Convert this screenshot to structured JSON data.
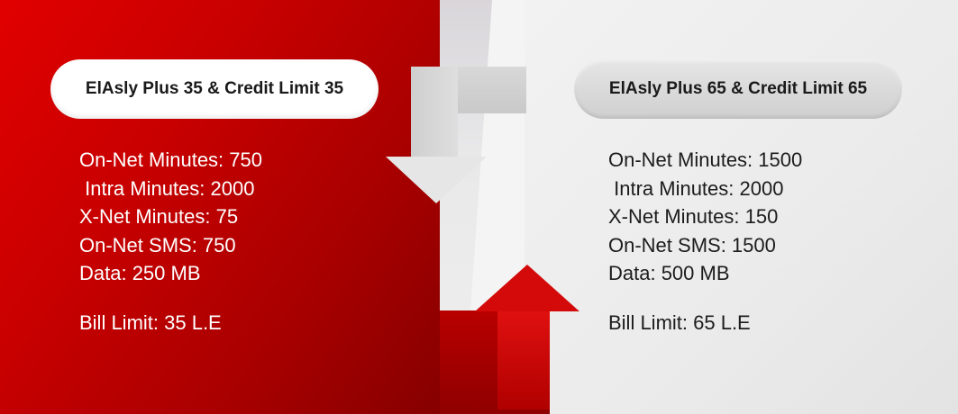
{
  "plans": [
    {
      "title": "ElAsly Plus 35 & Credit Limit 35",
      "features": [
        "On-Net Minutes: 750",
        " Intra Minutes: 2000",
        "X-Net Minutes: 75",
        "On-Net SMS: 750",
        "Data: 250 MB"
      ],
      "bill_limit": "Bill Limit: 35 L.E"
    },
    {
      "title": "ElAsly Plus 65 & Credit Limit 65",
      "features": [
        "On-Net Minutes: 1500",
        " Intra Minutes: 2000",
        "X-Net Minutes: 150",
        "On-Net SMS: 1500",
        "Data: 500 MB"
      ],
      "bill_limit": "Bill Limit: 65 L.E"
    }
  ],
  "colors": {
    "brand_red": "#e10000",
    "dark_red": "#860000",
    "panel_grey": "#ebebeb",
    "arrow_grey": "#d8d8d8"
  },
  "icons": {
    "down_arrow": "downgrade-arrow-icon",
    "up_arrow": "upgrade-arrow-icon"
  }
}
